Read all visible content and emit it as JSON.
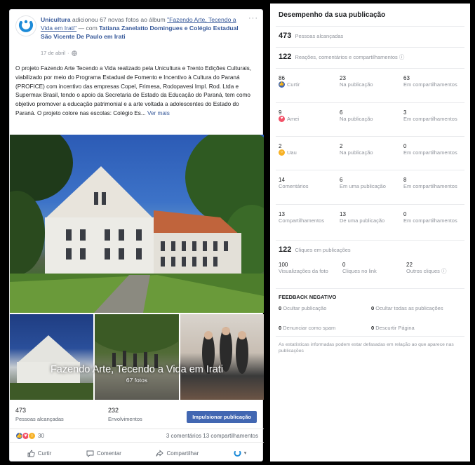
{
  "post": {
    "page_name": "Unicultura",
    "action_text": "adicionou 67 novas fotos ao álbum",
    "album_link": "\"Fazendo Arte, Tecendo a Vida em Irati\"",
    "with_text": "— com",
    "tagged_people": "Tatiana Zanelatto Domingues e Colégio Estadual São Vicente De Paulo em Irati",
    "date": "17 de abril",
    "more_icon": "···",
    "body": "O projeto Fazendo Arte Tecendo a Vida realizado pela Unicultura e Trento Edições Culturais, viabilizado por meio do Programa Estadual de Fomento e Incentivo à Cultura do Paraná (PROFICE) com incentivo das empresas Copel, Frimesa, Rodopavesi Impl. Rod. Ltda e Supermax Brasil, tendo o apoio da Secretaria de Estado da Educação do Paraná, tem como objetivo promover a educação patrimonial e a arte voltada a adolescentes do Estado do Paraná. O projeto colore nas escolas: Colégio Es...",
    "see_more": "Ver mais",
    "album_title": "Fazendo Arte, Tecendo a Vida em Irati",
    "album_count": "67 fotos",
    "reach_value": "473",
    "reach_label": "Pessoas alcançadas",
    "engagement_value": "232",
    "engagement_label": "Envolvimentos",
    "boost_label": "Impulsionar publicação",
    "reactions_count": "30",
    "comments_shares": "3 comentários  13 compartilhamentos",
    "actions": {
      "like": "Curtir",
      "comment": "Comentar",
      "share": "Compartilhar"
    },
    "colors": {
      "brand": "#4267b2",
      "link": "#365899",
      "love": "#f25268",
      "like": "#4267b2",
      "wow": "#f7b125"
    }
  },
  "insights": {
    "title": "Desempenho da sua publicação",
    "reach": {
      "value": "473",
      "label": "Pessoas alcançadas"
    },
    "reactions_summary": {
      "value": "122",
      "label": "Reações, comentários e compartilhamentos"
    },
    "info_icon": "ⓘ",
    "grid": [
      {
        "total": "86",
        "total_label": "Curtir",
        "icon": "like-icon",
        "post": "23",
        "post_label": "Na publicação",
        "shared": "63",
        "shared_label": "Em compartilhamentos"
      },
      {
        "total": "9",
        "total_label": "Amei",
        "icon": "love-icon",
        "post": "6",
        "post_label": "Na publicação",
        "shared": "3",
        "shared_label": "Em compartilhamentos"
      },
      {
        "total": "2",
        "total_label": "Uau",
        "icon": "wow-icon",
        "post": "2",
        "post_label": "Na publicação",
        "shared": "0",
        "shared_label": "Em compartilhamentos"
      },
      {
        "total": "14",
        "total_label": "Comentários",
        "icon": "",
        "post": "6",
        "post_label": "Em uma publicação",
        "shared": "8",
        "shared_label": "Em compartilhamentos"
      },
      {
        "total": "13",
        "total_label": "Compartilhamentos",
        "icon": "",
        "post": "13",
        "post_label": "De uma publicação",
        "shared": "0",
        "shared_label": "Em compartilhamentos"
      }
    ],
    "clicks": {
      "value": "122",
      "label": "Cliques em publicações"
    },
    "clicks_grid": [
      {
        "value": "100",
        "label": "Visualizações da foto"
      },
      {
        "value": "0",
        "label": "Cliques no link"
      },
      {
        "value": "22",
        "label": "Outros cliques"
      }
    ],
    "negative_title": "FEEDBACK NEGATIVO",
    "negative": [
      {
        "value": "0",
        "label": "Ocultar publicação"
      },
      {
        "value": "0",
        "label": "Ocultar todas as publicações"
      },
      {
        "value": "0",
        "label": "Denunciar como spam"
      },
      {
        "value": "0",
        "label": "Descurtir Página"
      }
    ],
    "footnote": "As estatísticas informadas podem estar defasadas em relação ao que aparece nas publicações"
  }
}
